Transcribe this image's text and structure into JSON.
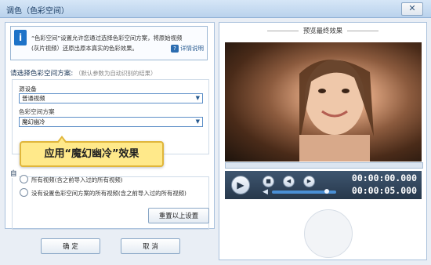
{
  "window": {
    "title": "调色（色彩空间）",
    "close_label": "✕"
  },
  "info": {
    "line1": "“色彩空间”设置允许您通过选择色彩空间方案，将原始视频",
    "line2": "(灰片视频）还原出原本真实的色彩效果。",
    "help_label": "详情说明"
  },
  "scheme": {
    "title": "请选择色彩空间方案:",
    "hint": "（默认参数为自动识别的结果）",
    "source_label": "源设备",
    "source_value": "普通视频",
    "color_label": "色彩空间方案",
    "color_value": "魔幻幽冷"
  },
  "tooltip": {
    "text": "应用“魔幻幽冷”效果"
  },
  "apply": {
    "title": "自",
    "option1": "所有视频(含之前导入过的所有视频)",
    "option2": "没有设置色彩空间方案的所有视频(含之前导入过的所有视频)",
    "reset_label": "重置以上设置"
  },
  "buttons": {
    "ok_label": "确 定",
    "cancel_label": "取 消"
  },
  "preview": {
    "title": "预览最终效果",
    "time_current": "00:00:00.000",
    "time_total": "00:00:05.000",
    "volume": 0.85
  },
  "colors": {
    "accent": "#1e73c8",
    "tooltip_bg": "#ffe98a",
    "playbar": "#2f4258"
  }
}
